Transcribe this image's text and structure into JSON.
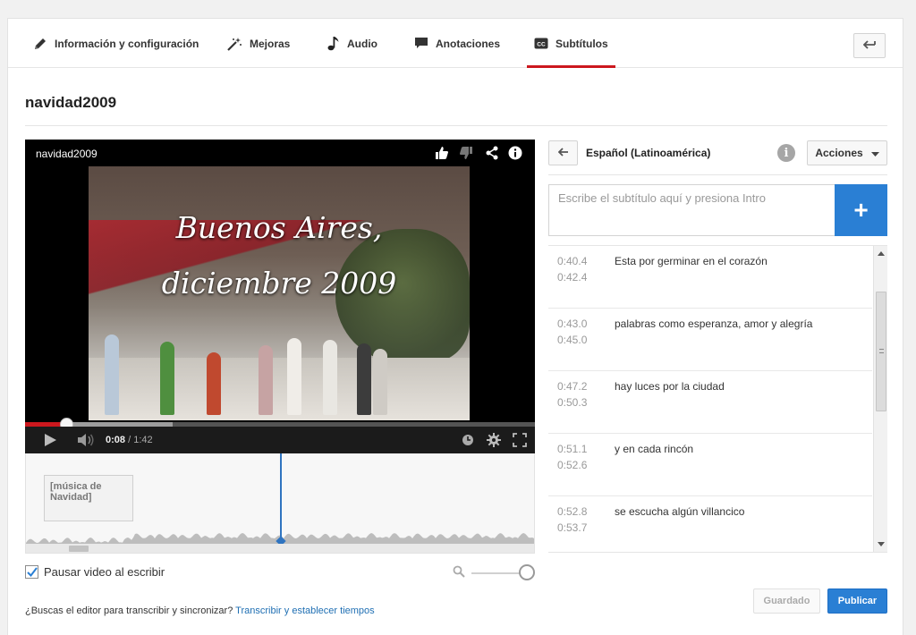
{
  "tabs": [
    {
      "label": "Información y configuración",
      "icon": "pencil-icon",
      "active": false
    },
    {
      "label": "Mejoras",
      "icon": "magic-wand-icon",
      "active": false
    },
    {
      "label": "Audio",
      "icon": "music-note-icon",
      "active": false
    },
    {
      "label": "Anotaciones",
      "icon": "speech-bubble-icon",
      "active": false
    },
    {
      "label": "Subtítulos",
      "icon": "cc-icon",
      "active": true
    }
  ],
  "video": {
    "title": "navidad2009",
    "player_title": "navidad2009",
    "caption": "Buenos Aires,\ndiciembre 2009",
    "current_time": "0:08",
    "duration": "1:42",
    "progress_fraction": 0.08,
    "loaded_fraction": 0.29
  },
  "timeline": {
    "cue_label": "[música de Navidad]"
  },
  "pause": {
    "label": "Pausar video al escribir",
    "checked": true
  },
  "help": {
    "text": "¿Buscas el editor para transcribir y sincronizar?",
    "link": "Transcribir y establecer tiempos"
  },
  "language": {
    "name": "Español (Latinoamérica)",
    "actions_label": "Acciones"
  },
  "subtitle_input": {
    "placeholder": "Escribe el subtítulo aquí y presiona Intro",
    "add_symbol": "+"
  },
  "subtitles": [
    {
      "start": "0:40.4",
      "end": "0:42.4",
      "text": "Esta por germinar en el corazón"
    },
    {
      "start": "0:43.0",
      "end": "0:45.0",
      "text": "palabras como esperanza, amor y alegría"
    },
    {
      "start": "0:47.2",
      "end": "0:50.3",
      "text": "hay luces por la ciudad"
    },
    {
      "start": "0:51.1",
      "end": "0:52.6",
      "text": "y en cada rincón"
    },
    {
      "start": "0:52.8",
      "end": "0:53.7",
      "text": "se escucha algún villancico"
    }
  ],
  "footer": {
    "saved_label": "Guardado",
    "publish_label": "Publicar"
  },
  "colors": {
    "accent_red": "#cc181e",
    "accent_blue": "#2a7fd4"
  }
}
